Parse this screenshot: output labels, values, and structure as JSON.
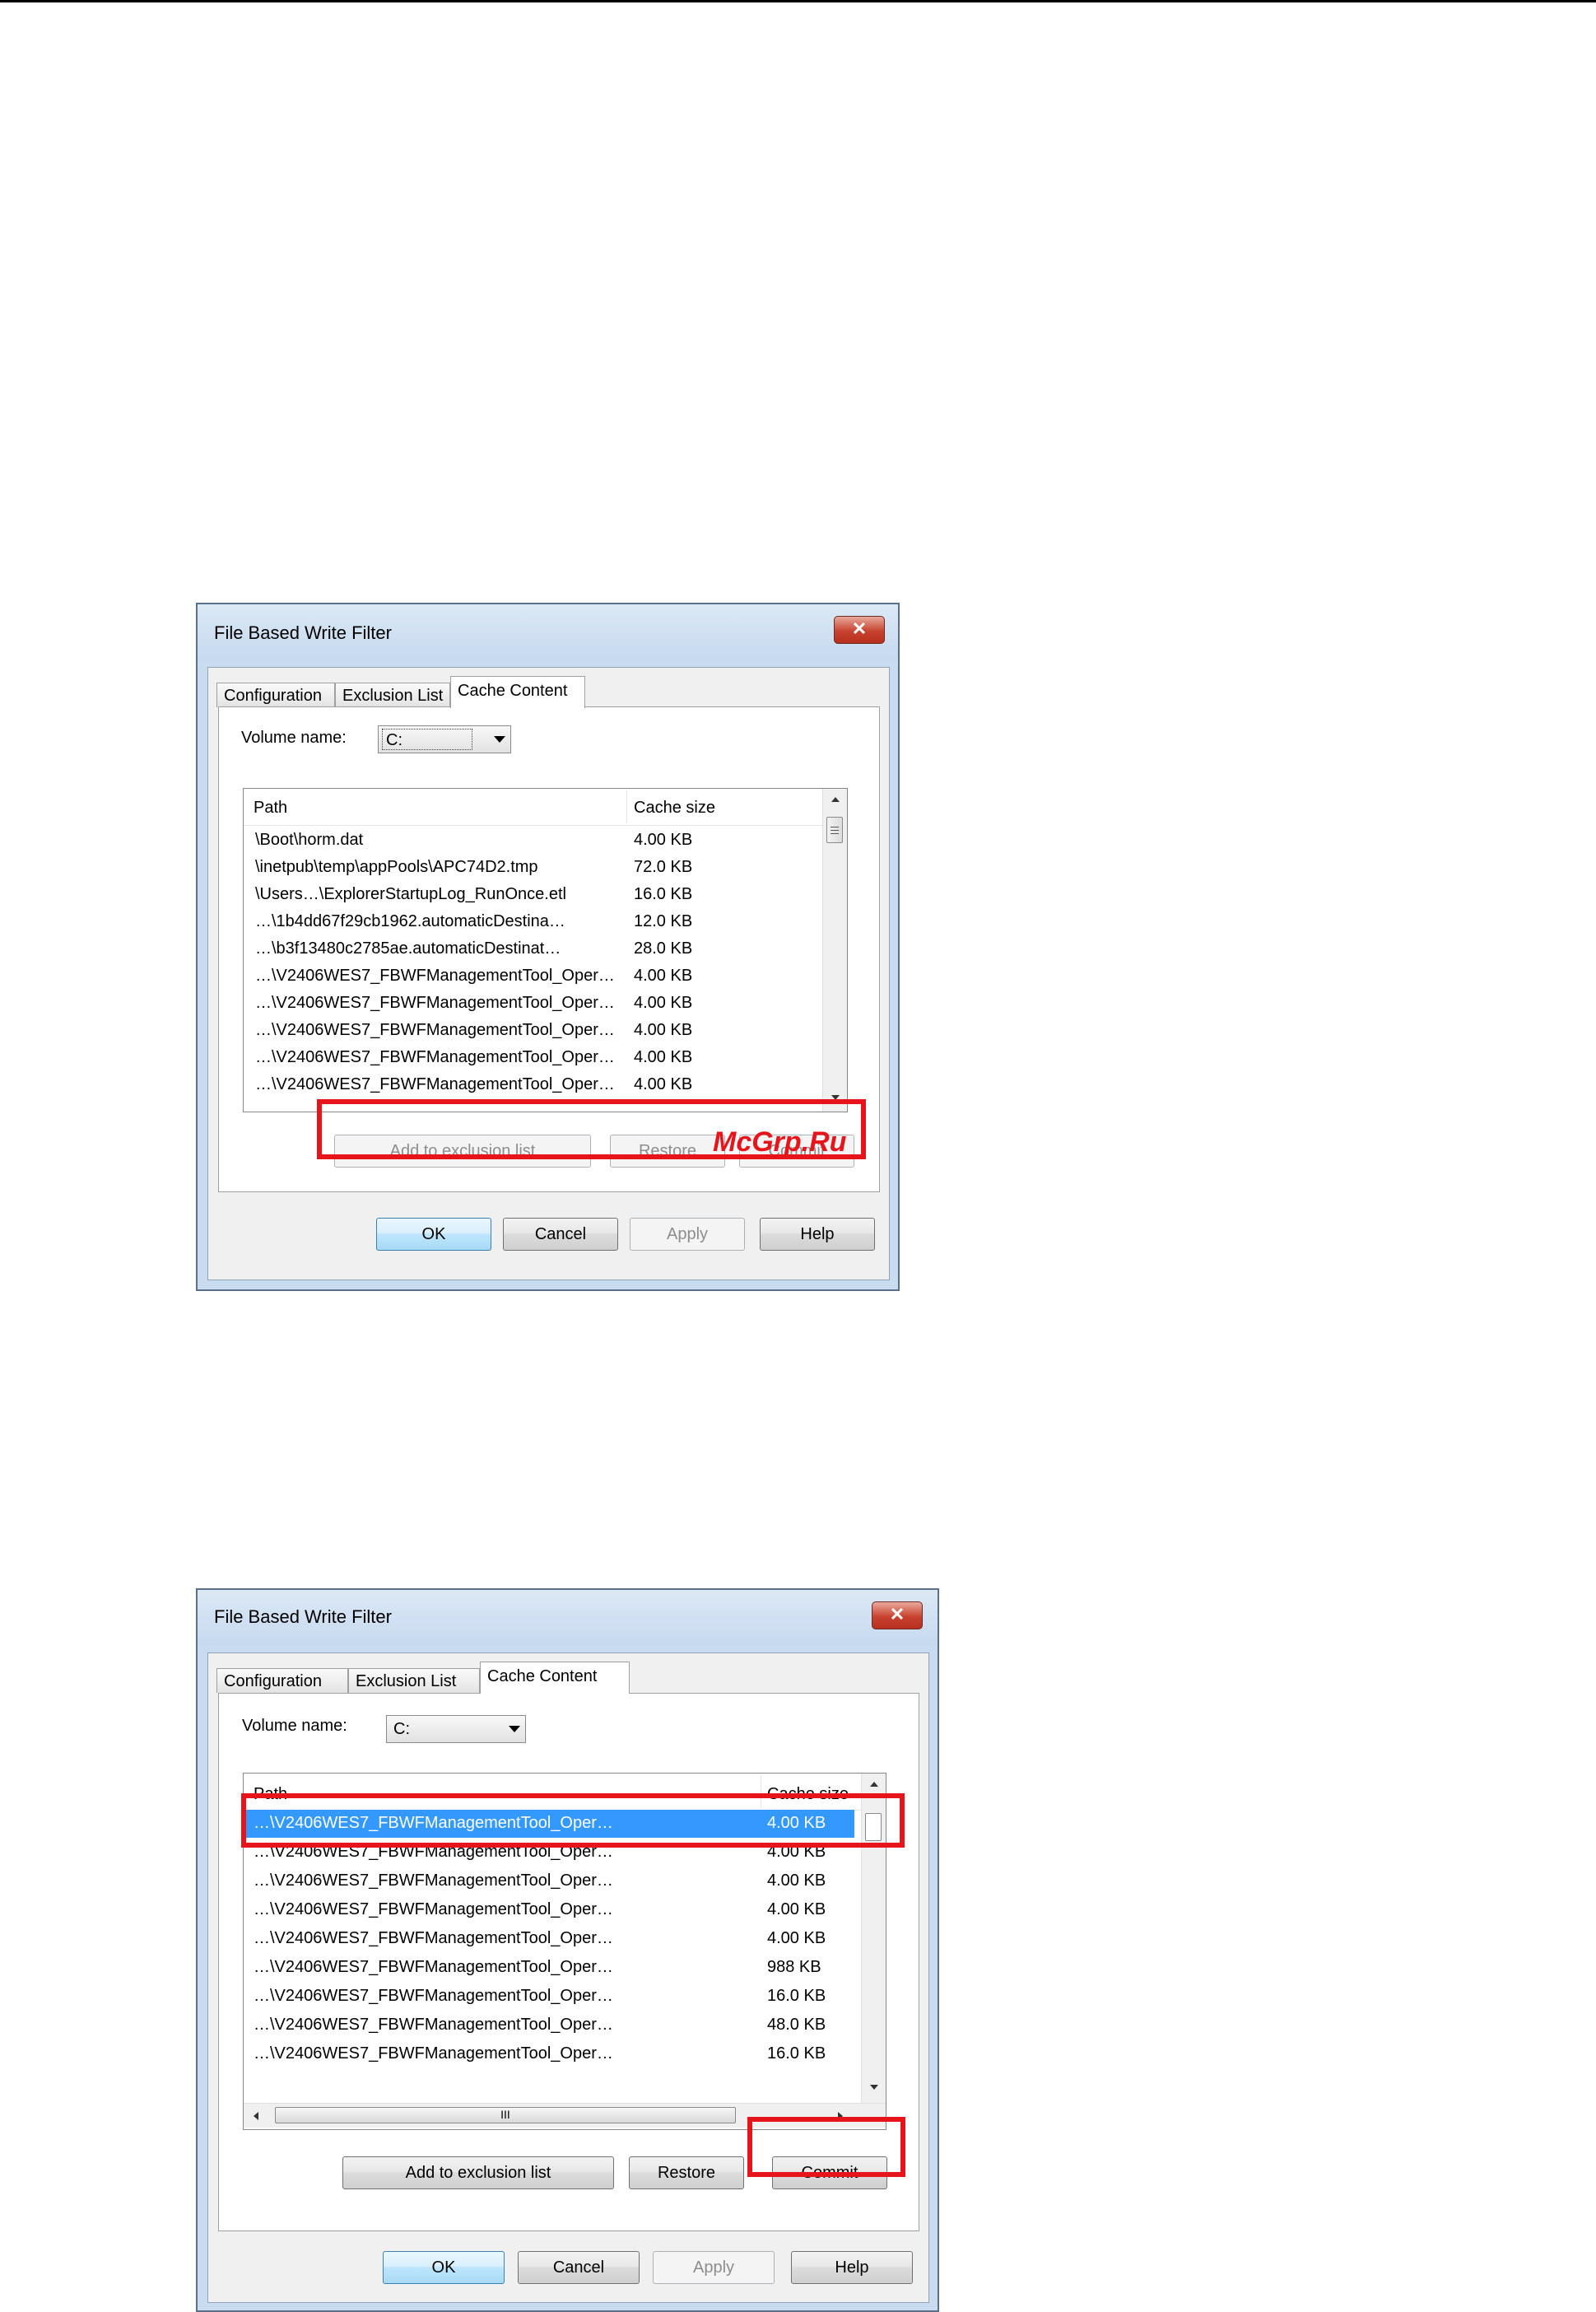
{
  "dialog1": {
    "title": "File Based Write Filter",
    "close_glyph": "✕",
    "tabs": [
      "Configuration",
      "Exclusion List",
      "Cache Content"
    ],
    "volume_label": "Volume name:",
    "volume_value": "C:",
    "columns": [
      "Path",
      "Cache size"
    ],
    "rows": [
      {
        "path": "\\Boot\\horm.dat",
        "size": "4.00 KB"
      },
      {
        "path": "\\inetpub\\temp\\appPools\\APC74D2.tmp",
        "size": "72.0 KB"
      },
      {
        "path": "\\Users…\\ExplorerStartupLog_RunOnce.etl",
        "size": "16.0 KB"
      },
      {
        "path": "…\\1b4dd67f29cb1962.automaticDestina…",
        "size": "12.0 KB"
      },
      {
        "path": "…\\b3f13480c2785ae.automaticDestinat…",
        "size": "28.0 KB"
      },
      {
        "path": "…\\V2406WES7_FBWFManagementTool_Oper…",
        "size": "4.00 KB"
      },
      {
        "path": "…\\V2406WES7_FBWFManagementTool_Oper…",
        "size": "4.00 KB"
      },
      {
        "path": "…\\V2406WES7_FBWFManagementTool_Oper…",
        "size": "4.00 KB"
      },
      {
        "path": "…\\V2406WES7_FBWFManagementTool_Oper…",
        "size": "4.00 KB"
      },
      {
        "path": "…\\V2406WES7_FBWFManagementTool_Oper…",
        "size": "4.00 KB"
      }
    ],
    "action_buttons": {
      "add": "Add to exclusion list",
      "restore": "Restore",
      "commit": "Commit"
    },
    "footer_buttons": {
      "ok": "OK",
      "cancel": "Cancel",
      "apply": "Apply",
      "help": "Help"
    },
    "buttons_enabled": false
  },
  "watermark": "McGrp.Ru",
  "dialog2": {
    "title": "File Based Write Filter",
    "close_glyph": "✕",
    "tabs": [
      "Configuration",
      "Exclusion List",
      "Cache Content"
    ],
    "volume_label": "Volume name:",
    "volume_value": "C:",
    "columns": [
      "Path",
      "Cache size"
    ],
    "selected_row_index": 0,
    "rows": [
      {
        "path": "…\\V2406WES7_FBWFManagementTool_Oper…",
        "size": "4.00 KB"
      },
      {
        "path": "…\\V2406WES7_FBWFManagementTool_Oper…",
        "size": "4.00 KB"
      },
      {
        "path": "…\\V2406WES7_FBWFManagementTool_Oper…",
        "size": "4.00 KB"
      },
      {
        "path": "…\\V2406WES7_FBWFManagementTool_Oper…",
        "size": "4.00 KB"
      },
      {
        "path": "…\\V2406WES7_FBWFManagementTool_Oper…",
        "size": "4.00 KB"
      },
      {
        "path": "…\\V2406WES7_FBWFManagementTool_Oper…",
        "size": "988 KB"
      },
      {
        "path": "…\\V2406WES7_FBWFManagementTool_Oper…",
        "size": "16.0 KB"
      },
      {
        "path": "…\\V2406WES7_FBWFManagementTool_Oper…",
        "size": "48.0 KB"
      },
      {
        "path": "…\\V2406WES7_FBWFManagementTool_Oper…",
        "size": "16.0 KB"
      }
    ],
    "hscroll_thumb_glyph": "III",
    "action_buttons": {
      "add": "Add to exclusion list",
      "restore": "Restore",
      "commit": "Commit"
    },
    "footer_buttons": {
      "ok": "OK",
      "cancel": "Cancel",
      "apply": "Apply",
      "help": "Help"
    },
    "buttons_enabled": true
  },
  "colors": {
    "highlight": "#e8141b",
    "selection": "#3399ff",
    "titlebar": "#c9dcef"
  }
}
